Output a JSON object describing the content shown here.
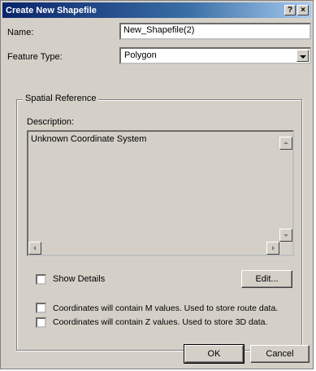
{
  "window": {
    "title": "Create New Shapefile",
    "help_btn": "?",
    "close_btn": "×"
  },
  "form": {
    "name_label": "Name:",
    "name_value": "New_Shapefile(2)",
    "feature_type_label": "Feature Type:",
    "feature_type_value": "Polygon"
  },
  "spatial_reference": {
    "group_label": "Spatial Reference",
    "description_label": "Description:",
    "description_text": "Unknown Coordinate System",
    "show_details_label": "Show Details",
    "edit_label": "Edit..."
  },
  "options": {
    "m_values_label": "Coordinates will contain M values. Used to store route data.",
    "z_values_label": "Coordinates will contain Z values. Used to store 3D data."
  },
  "buttons": {
    "ok": "OK",
    "cancel": "Cancel"
  }
}
